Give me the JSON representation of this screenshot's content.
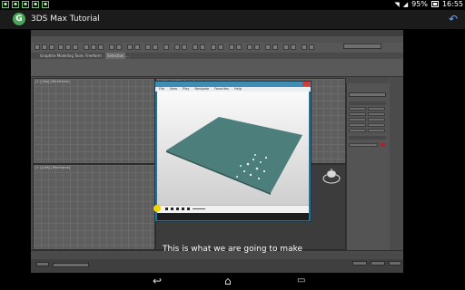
{
  "status_bar": {
    "battery": "95%",
    "time": "16:55"
  },
  "app_bar": {
    "title": "3DS Max Tutorial",
    "icon_letter": "G",
    "share_icon": "share-back-icon"
  },
  "video": {
    "subtitle": "This is what we are going to make",
    "max_ribbon_tabs": [
      "Graphite Modeling Tools",
      "Freeform",
      "Selection",
      "..."
    ],
    "player_menu": [
      "File",
      "View",
      "Play",
      "Navigate",
      "Favorites",
      "Help"
    ],
    "viewport_labels": [
      "[+] [Top] [Wireframe]",
      "[+] [Left] [Wireframe]",
      "[+] [Front] [Wireframe]"
    ]
  },
  "colors": {
    "accent_green": "#4da35a",
    "share_blue": "#6aa6ff",
    "cursor_yellow": "#f3d300",
    "swatch_red": "#b81d2a"
  },
  "nav_bar": {
    "back": "back-icon",
    "home": "home-icon",
    "recents": "recents-icon"
  }
}
